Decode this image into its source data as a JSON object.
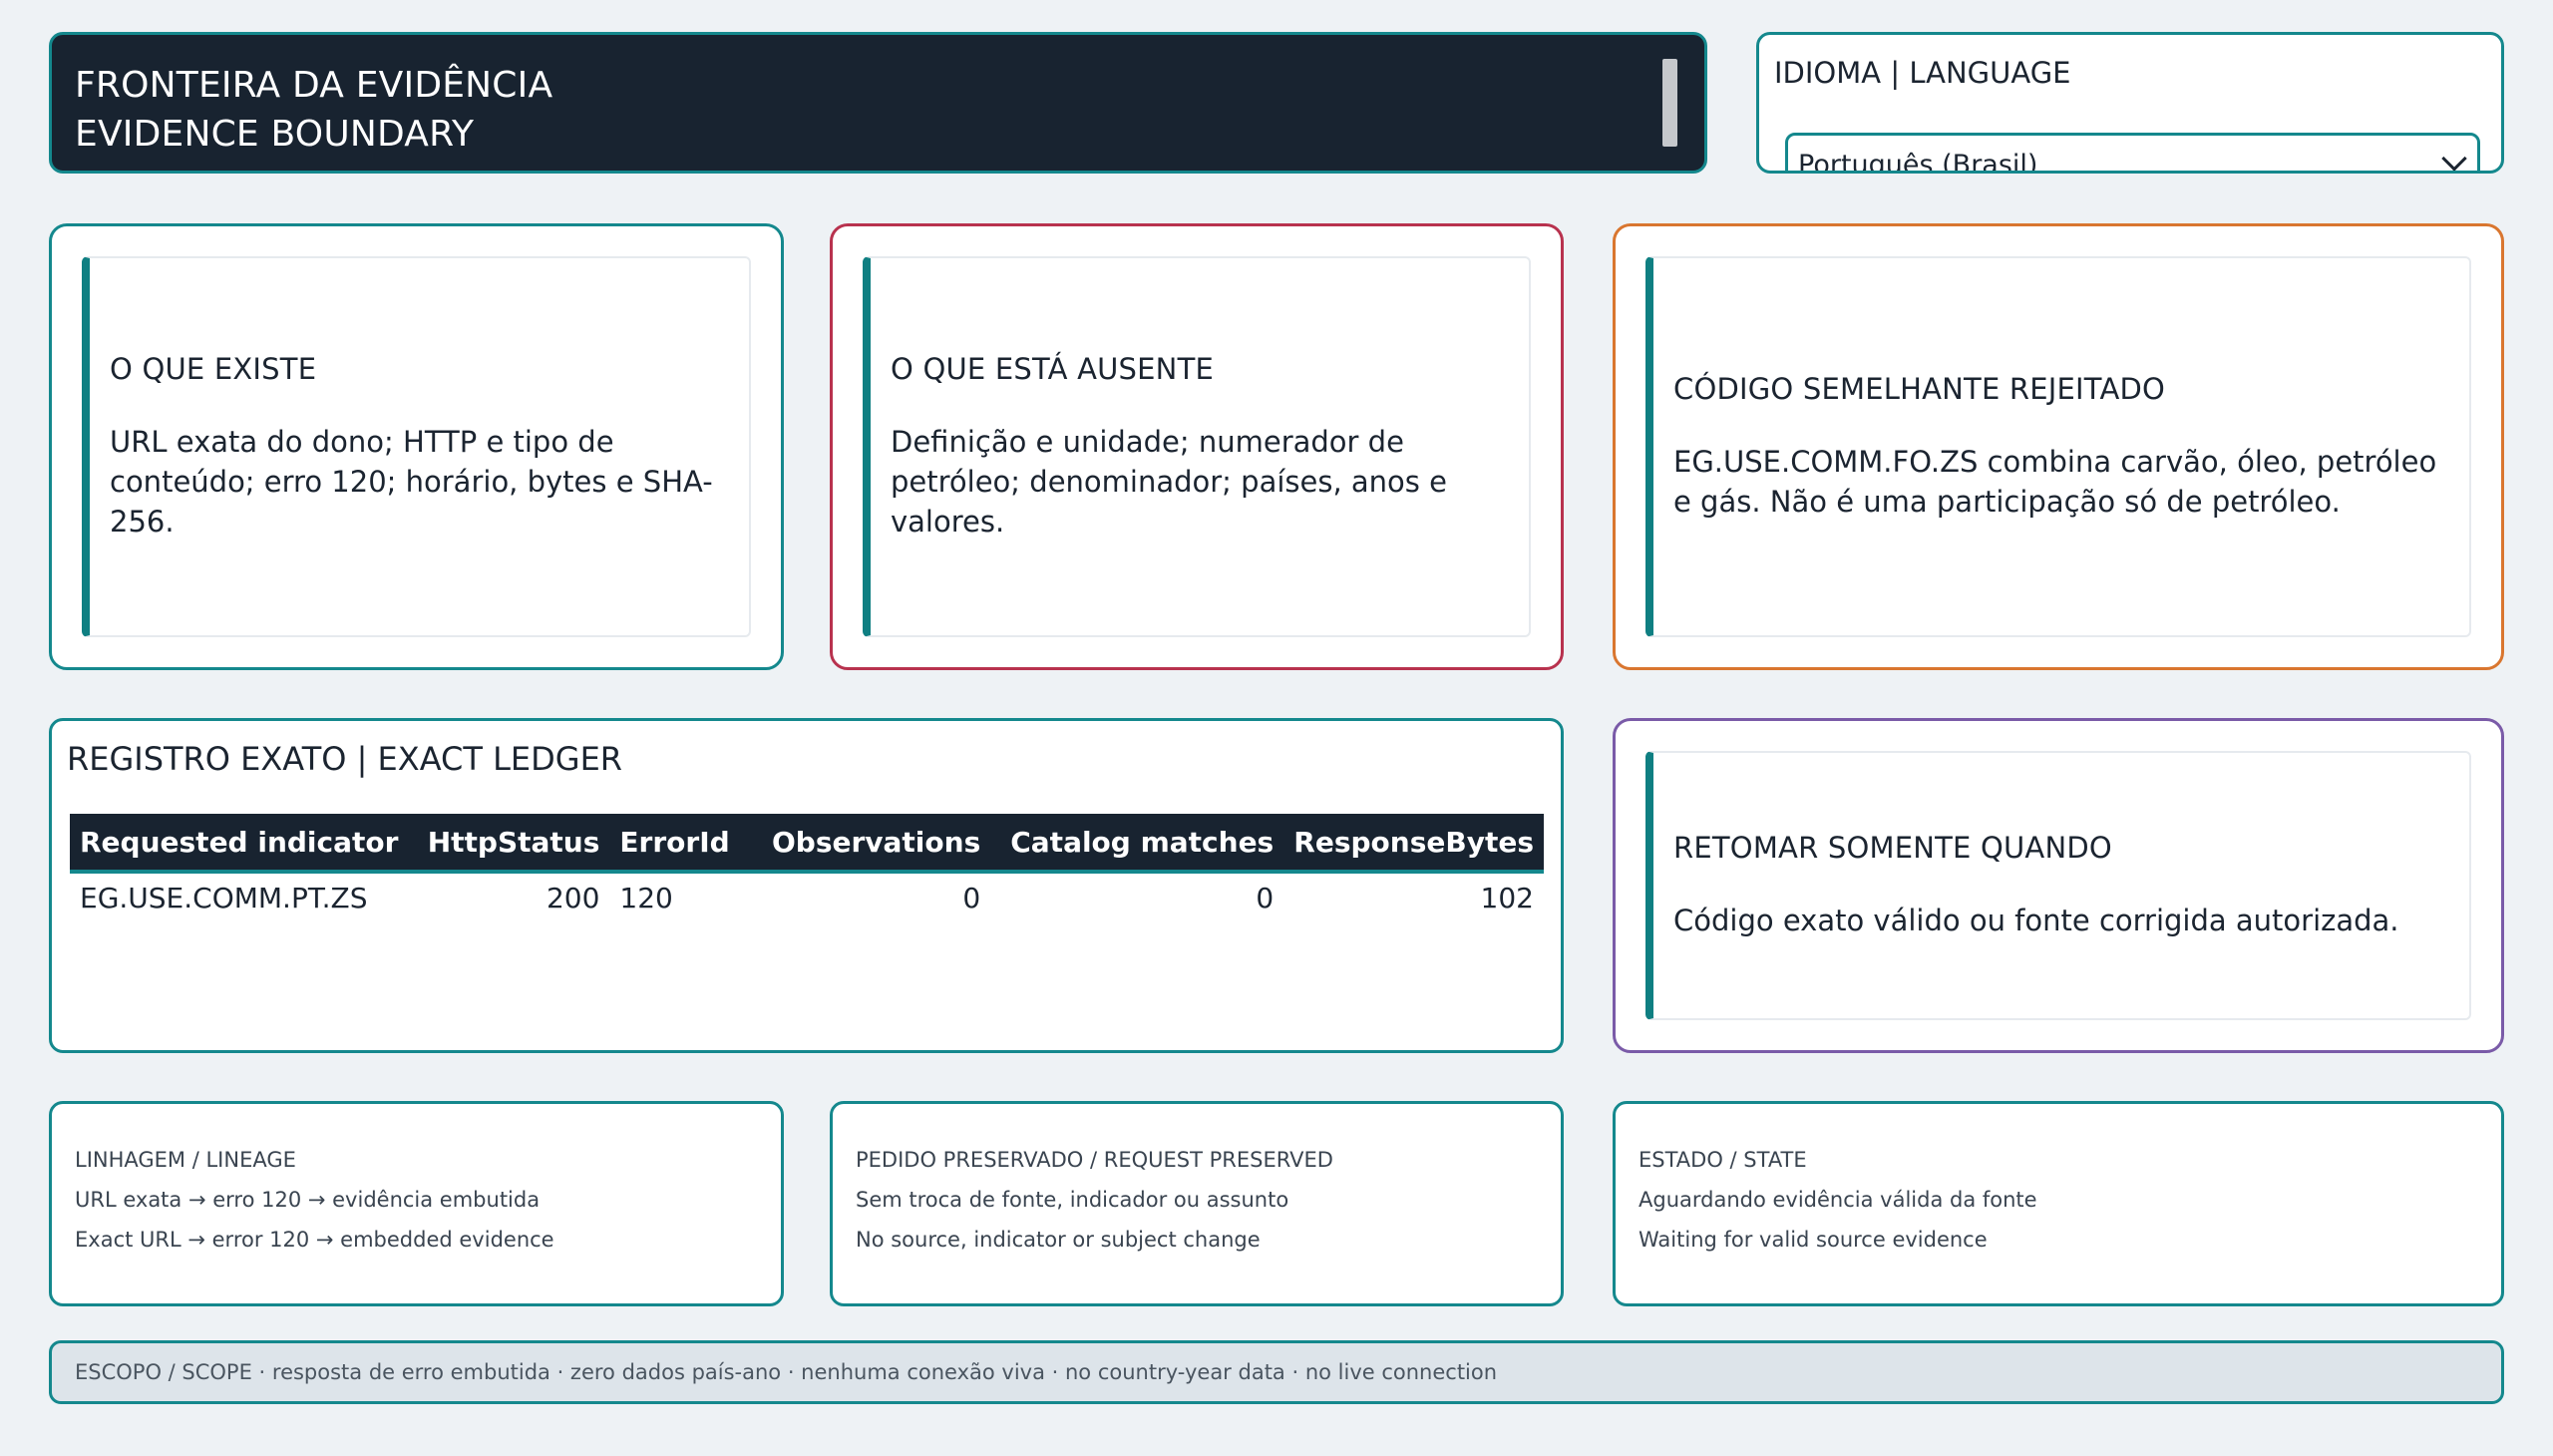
{
  "header": {
    "title_line1": "FRONTEIRA DA EVIDÊNCIA",
    "title_line2": "EVIDENCE BOUNDARY"
  },
  "language": {
    "title": "IDIOMA | LANGUAGE",
    "selected": "Português (Brasil)"
  },
  "cards": [
    {
      "heading": "O QUE EXISTE",
      "body": "URL exata do dono; HTTP e tipo de conteúdo; erro 120; horário, bytes e SHA-256.",
      "border_color": "#14888d"
    },
    {
      "heading": "O QUE ESTÁ AUSENTE",
      "body": "Definição e unidade; numerador de petróleo; denominador; países, anos e valores.",
      "border_color": "#b8324e"
    },
    {
      "heading": "CÓDIGO SEMELHANTE REJEITADO",
      "body": "EG.USE.COMM.FO.ZS combina carvão, óleo, petróleo e gás. Não é uma participação só de petróleo.",
      "border_color": "#d9762f"
    }
  ],
  "ledger": {
    "title": "REGISTRO EXATO | EXACT LEDGER",
    "columns": [
      "Requested indicator",
      "HttpStatus",
      "ErrorId",
      "Observations",
      "Catalog matches",
      "ResponseBytes"
    ],
    "rows": [
      [
        "EG.USE.COMM.PT.ZS",
        "200",
        "120",
        "0",
        "0",
        "102"
      ]
    ]
  },
  "resume": {
    "heading": "RETOMAR SOMENTE QUANDO",
    "body": "Código exato válido ou fonte corrigida autorizada.",
    "border_color": "#7a5ba8"
  },
  "info": [
    {
      "title": "LINHAGEM / LINEAGE",
      "line1": "URL exata → erro 120 → evidência embutida",
      "line2": "Exact URL → error 120 → embedded evidence"
    },
    {
      "title": "PEDIDO PRESERVADO / REQUEST PRESERVED",
      "line1": "Sem troca de fonte, indicador ou assunto",
      "line2": "No source, indicator or subject change"
    },
    {
      "title": "ESTADO / STATE",
      "line1": "Aguardando evidência válida da fonte",
      "line2": "Waiting for valid source evidence"
    }
  ],
  "scope": {
    "text": "ESCOPO / SCOPE · resposta de erro embutida · zero dados país-ano · nenhuma conexão viva · no country-year data · no live connection"
  },
  "colors": {
    "teal_accent": "#14888d",
    "navy": "#182330",
    "background": "#eef2f5"
  }
}
